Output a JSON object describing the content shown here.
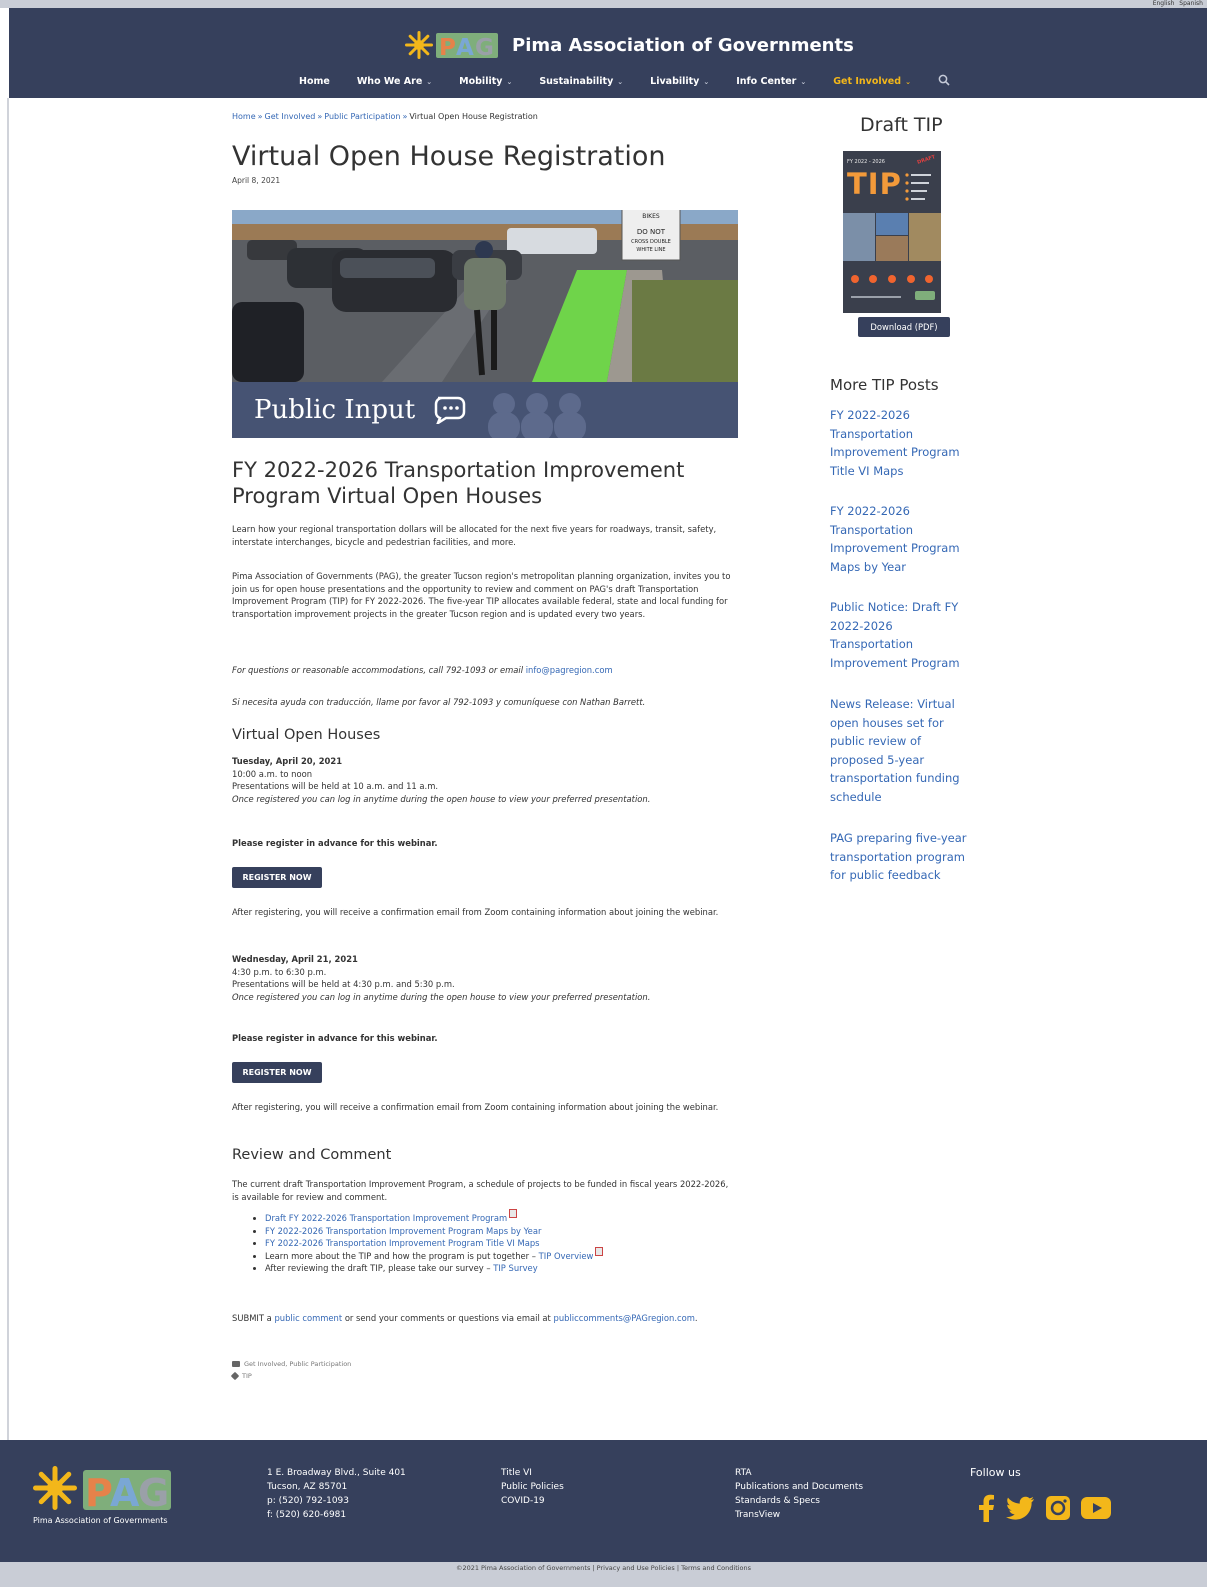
{
  "language_bar": [
    "English",
    "Spanish"
  ],
  "header": {
    "site_title": "Pima Association of Governments",
    "nav": [
      {
        "label": "Home",
        "has_menu": false
      },
      {
        "label": "Who We Are",
        "has_menu": true
      },
      {
        "label": "Mobility",
        "has_menu": true
      },
      {
        "label": "Sustainability",
        "has_menu": true
      },
      {
        "label": "Livability",
        "has_menu": true
      },
      {
        "label": "Info Center",
        "has_menu": true
      },
      {
        "label": "Get Involved",
        "has_menu": true,
        "active": true
      }
    ],
    "caret": "⌄"
  },
  "breadcrumb": {
    "items": [
      "Home",
      "Get Involved",
      "Public Participation"
    ],
    "separator": "»",
    "current": "Virtual Open House Registration"
  },
  "page": {
    "title": "Virtual Open House Registration",
    "date": "April 8, 2021",
    "hero_label": "Public Input",
    "hero_signs": [
      "BIKES",
      "DO NOT",
      "CROSS DOUBLE",
      "WHITE LINE"
    ]
  },
  "content": {
    "heading": "FY 2022-2026 Transportation Improvement Program Virtual Open Houses",
    "intro": "Learn how your regional transportation dollars will be allocated for the next five years for roadways, transit, safety, interstate interchanges, bicycle and pedestrian facilities, and more.",
    "body": "Pima Association of Governments (PAG), the greater Tucson region's metropolitan planning organization, invites you to join us for open house presentations and the opportunity to review and comment on PAG's draft Transportation Improvement Program (TIP) for FY 2022-2026. The five-year TIP allocates available federal, state and local funding for transportation improvement projects in the greater Tucson region and is updated every two years.",
    "contact_text": "For questions or reasonable accommodations, call 792-1093 or email",
    "contact_email": "info@pagregion.com",
    "spanish_note": "Si necesita ayuda con traducción, llame por favor al 792-1093 y comuníquese con Nathan Barrett.",
    "open_houses_heading": "Virtual Open Houses",
    "sessions": [
      {
        "date": "Tuesday, April 20, 2021",
        "time": "10:00 a.m. to noon",
        "presentations": "Presentations will be held at 10 a.m. and 11 a.m.",
        "note": "Once registered you can log in anytime during the open house to view your preferred presentation.",
        "register_prompt": "Please register in advance for this webinar.",
        "button": "REGISTER NOW",
        "after": "After registering, you will receive a confirmation email from Zoom containing information about joining the webinar."
      },
      {
        "date": "Wednesday, April 21, 2021",
        "time": "4:30 p.m. to 6:30 p.m.",
        "presentations": "Presentations will be held at 4:30 p.m. and 5:30 p.m.",
        "note": "Once registered you can log in anytime during the open house to view your preferred presentation.",
        "register_prompt": "Please register in advance for this webinar.",
        "button": "REGISTER NOW",
        "after": "After registering, you will receive a confirmation email from Zoom containing information about joining the webinar."
      }
    ],
    "review_heading": "Review and Comment",
    "review_text": "The current draft Transportation Improvement Program, a schedule of projects to be funded in fiscal years 2022-2026, is available for review and comment.",
    "review_links": {
      "l1": "Draft FY 2022-2026 Transportation Improvement Program",
      "l2": "FY 2022-2026 Transportation Improvement Program Maps by Year",
      "l3": "FY 2022-2026 Transportation Improvement Program Title VI Maps",
      "l4_text": "Learn more about the TIP and how the program is put together –",
      "l4_link": "TIP Overview",
      "l5_text": "After reviewing the draft TIP, please take our survey –",
      "l5_link": "TIP Survey"
    },
    "submit_pre": "SUBMIT a",
    "submit_link": "public comment",
    "submit_post": "or send your comments or questions via email at",
    "submit_email": "publiccomments@PAGregion.com",
    "submit_end": ".",
    "categories": "Get Involved, Public Participation",
    "tags": "TIP"
  },
  "sidebar": {
    "title": "Draft TIP",
    "cover_fy": "FY 2022 - 2026",
    "cover_tip": "TIP",
    "cover_draft": "DRAFT",
    "download": "Download (PDF)",
    "more_heading": "More TIP Posts",
    "posts": [
      "FY 2022-2026 Transportation Improvement Program Title VI Maps",
      "FY 2022-2026 Transportation Improvement Program Maps by Year",
      "Public Notice: Draft FY 2022-2026 Transportation Improvement Program",
      "News Release: Virtual open houses set for public review of proposed 5-year transportation funding schedule",
      "PAG preparing five-year transportation program for public feedback"
    ]
  },
  "footer": {
    "logo_caption": "Pima Association of Governments",
    "address": [
      "1 E. Broadway Blvd., Suite 401",
      "Tucson, AZ 85701",
      "p: (520) 792-1093",
      "f: (520) 620-6981"
    ],
    "col2": [
      "Title VI",
      "Public Policies",
      "COVID-19"
    ],
    "col3": [
      "RTA",
      "Publications and Documents",
      "Standards & Specs",
      "TransView"
    ],
    "follow": "Follow us",
    "social_icons": [
      "facebook-icon",
      "twitter-icon",
      "instagram-icon",
      "youtube-icon"
    ],
    "copyright": "©2021 Pima Association of Governments | Privacy and Use Policies | Terms and Conditions"
  },
  "colors": {
    "header_bg": "#36405c",
    "accent": "#f3b71a",
    "link": "#3568b5",
    "band": "#465373"
  }
}
